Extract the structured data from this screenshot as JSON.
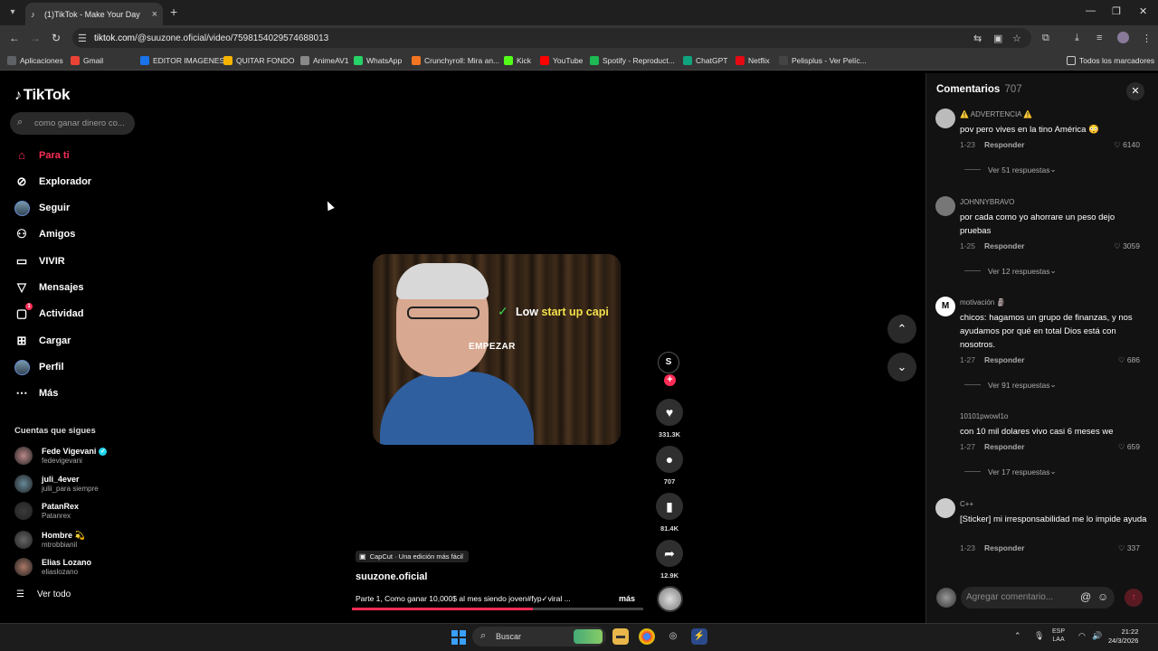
{
  "browser": {
    "tab_title": "(1)TikTok - Make Your Day",
    "url_prefix": "tiktok.com",
    "url_path": "/@suuzone.oficial/video/7598154029574688013"
  },
  "bookmarks": [
    {
      "label": "Aplicaciones",
      "icon": "apps-icon",
      "color": "#5f6368"
    },
    {
      "label": "Gmail",
      "icon": "gmail-icon",
      "color": "#ea4335"
    },
    {
      "label": "EDITOR IMAGENES",
      "icon": "editor-icon",
      "color": "#1a73e8"
    },
    {
      "label": "QUITAR FONDO",
      "icon": "quitar-fondo-icon",
      "color": "#f4b400"
    },
    {
      "label": "AnimeAV1",
      "icon": "anime-icon",
      "color": "#888888"
    },
    {
      "label": "WhatsApp",
      "icon": "whatsapp-icon",
      "color": "#25d366"
    },
    {
      "label": "Crunchyroll: Mira an...",
      "icon": "crunchyroll-icon",
      "color": "#f47521"
    },
    {
      "label": "Kick",
      "icon": "kick-icon",
      "color": "#53fc18"
    },
    {
      "label": "YouTube",
      "icon": "youtube-icon",
      "color": "#ff0000"
    },
    {
      "label": "Spotify - Reproduct...",
      "icon": "spotify-icon",
      "color": "#1db954"
    },
    {
      "label": "ChatGPT",
      "icon": "chatgpt-icon",
      "color": "#10a37f"
    },
    {
      "label": "Netflix",
      "icon": "netflix-icon",
      "color": "#e50914"
    },
    {
      "label": "Pelisplus - Ver Pelíc...",
      "icon": "pelisplus-icon",
      "color": "#444444"
    }
  ],
  "bookmarks_all": "Todos los marcadores",
  "sidebar": {
    "logo": "TikTok",
    "search_placeholder": "como ganar dinero co...",
    "nav": [
      {
        "label": "Para ti",
        "icon": "home-icon",
        "active": true
      },
      {
        "label": "Explorador",
        "icon": "compass-icon"
      },
      {
        "label": "Seguir",
        "icon": "following-icon"
      },
      {
        "label": "Amigos",
        "icon": "friends-icon"
      },
      {
        "label": "VIVIR",
        "icon": "live-icon"
      },
      {
        "label": "Mensajes",
        "icon": "messages-icon"
      },
      {
        "label": "Actividad",
        "icon": "activity-icon",
        "badge": "1"
      },
      {
        "label": "Cargar",
        "icon": "upload-icon"
      },
      {
        "label": "Perfil",
        "icon": "profile-icon"
      },
      {
        "label": "Más",
        "icon": "more-icon"
      }
    ],
    "following_title": "Cuentas que sigues",
    "following": [
      {
        "name": "Fede Vigevani",
        "username": "fedevigevani",
        "verified": true
      },
      {
        "name": "juli_4ever",
        "username": "julii_para siempre"
      },
      {
        "name": "PatanRex",
        "username": "Patanrex"
      },
      {
        "name": "Hombre 💫",
        "username": "mtrobbianil"
      },
      {
        "name": "Elias Lozano",
        "username": "eliaslozano"
      }
    ],
    "see_all": "Ver todo"
  },
  "video": {
    "overlay_caption_white": "Low",
    "overlay_caption_yellow": "start up capi",
    "overlay_word": "EMPEZAR",
    "capcut_label": "CapCut · Una edición más fácil",
    "author": "suuzone.oficial",
    "description": "Parte 1, Como ganar 10,000$ al mes siendo joven#fyp✓viral ...",
    "more_label": "más",
    "progress": 0.62,
    "creator_initial": "S",
    "likes": "331.3K",
    "comments": "707",
    "saves": "81.4K",
    "shares": "12.9K"
  },
  "comments_panel": {
    "title": "Comentarios",
    "count": "707",
    "input_placeholder": "Agregar comentario...",
    "reply_label": "Responder",
    "items": [
      {
        "user": "⚠️ ADVERTENCIA ⚠️",
        "text": "pov pero vives en la tino América 😳",
        "date": "1-23",
        "likes": "6140",
        "replies": "Ver 51 respuestas"
      },
      {
        "user": "JOHNNYBRAVO",
        "text": "por cada como yo ahorrare un peso dejo pruebas",
        "date": "1-25",
        "likes": "3059",
        "replies": "Ver 12 respuestas"
      },
      {
        "user": "motivación 🗿",
        "text": "chicos: hagamos un grupo de finanzas, y nos ayudamos por qué en total Dios está con nosotros.",
        "date": "1-27",
        "likes": "686",
        "replies": "Ver 91 respuestas",
        "initial": "M"
      },
      {
        "user": "10101pwowl1o",
        "text": "con 10 mil dolares vivo casi 6 meses we",
        "date": "1-27",
        "likes": "659",
        "replies": "Ver 17 respuestas"
      },
      {
        "user": "C++",
        "text": "[Sticker] mi irresponsabilidad me lo impide ayuda",
        "date": "1-23",
        "likes": "337",
        "replies": ""
      }
    ]
  },
  "taskbar": {
    "search_label": "Buscar",
    "lang": "ESP",
    "region": "LAA",
    "time": "21:22",
    "date": "24/3/2026"
  },
  "colors": {
    "accent": "#fe2c55",
    "verified": "#20d5ec",
    "caption_highlight": "#f5e14a"
  }
}
